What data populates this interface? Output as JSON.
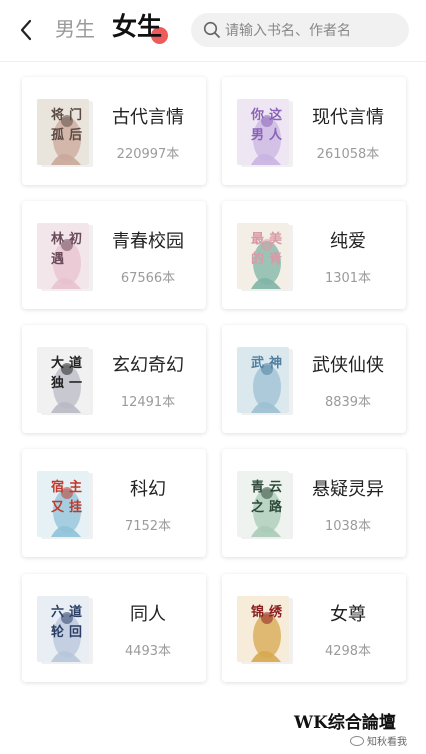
{
  "header": {
    "tab_male": "男生",
    "tab_female": "女生",
    "search_placeholder": "请输入书名、作者名",
    "accent": "#f05a5a"
  },
  "categories": [
    {
      "title": "古代言情",
      "count": "220997本",
      "cover_text": "将门孤后",
      "cover_colors": [
        "#e9e4dc",
        "#5c4b45",
        "#c9a89a"
      ]
    },
    {
      "title": "现代言情",
      "count": "261058本",
      "cover_text": "你这男人又撩了",
      "cover_colors": [
        "#efe6f3",
        "#8a63b8",
        "#c9b4e2"
      ]
    },
    {
      "title": "青春校园",
      "count": "67566本",
      "cover_text": "林初遇",
      "cover_colors": [
        "#f3e6ea",
        "#6a4b5a",
        "#e8c2ce"
      ]
    },
    {
      "title": "纯爱",
      "count": "1301本",
      "cover_text": "最美的青春",
      "cover_colors": [
        "#f4efe6",
        "#d89aa6",
        "#7fb5a6"
      ]
    },
    {
      "title": "玄幻奇幻",
      "count": "12491本",
      "cover_text": "大道独一",
      "cover_colors": [
        "#f1f1f1",
        "#222222",
        "#b9b9c4"
      ]
    },
    {
      "title": "武侠仙侠",
      "count": "8839本",
      "cover_text": "武神",
      "cover_colors": [
        "#dbe8ee",
        "#4f7fa0",
        "#9cc0d2"
      ]
    },
    {
      "title": "科幻",
      "count": "7152本",
      "cover_text": "宿主又挂了",
      "cover_colors": [
        "#e6f1f5",
        "#c0392b",
        "#8fc2d8"
      ]
    },
    {
      "title": "悬疑灵异",
      "count": "1038本",
      "cover_text": "青云之路",
      "cover_colors": [
        "#eef3ef",
        "#2f4a3a",
        "#a9cbb7"
      ]
    },
    {
      "title": "同人",
      "count": "4493本",
      "cover_text": "六道轮回",
      "cover_colors": [
        "#e9eef4",
        "#2c3e66",
        "#b7c6dc"
      ]
    },
    {
      "title": "女尊",
      "count": "4298本",
      "cover_text": "锦绣",
      "cover_colors": [
        "#f6ecd9",
        "#8b1e1e",
        "#d7a84f"
      ]
    }
  ],
  "watermark": {
    "text": "WK综合論壇",
    "logo_text": "知秋看我"
  }
}
